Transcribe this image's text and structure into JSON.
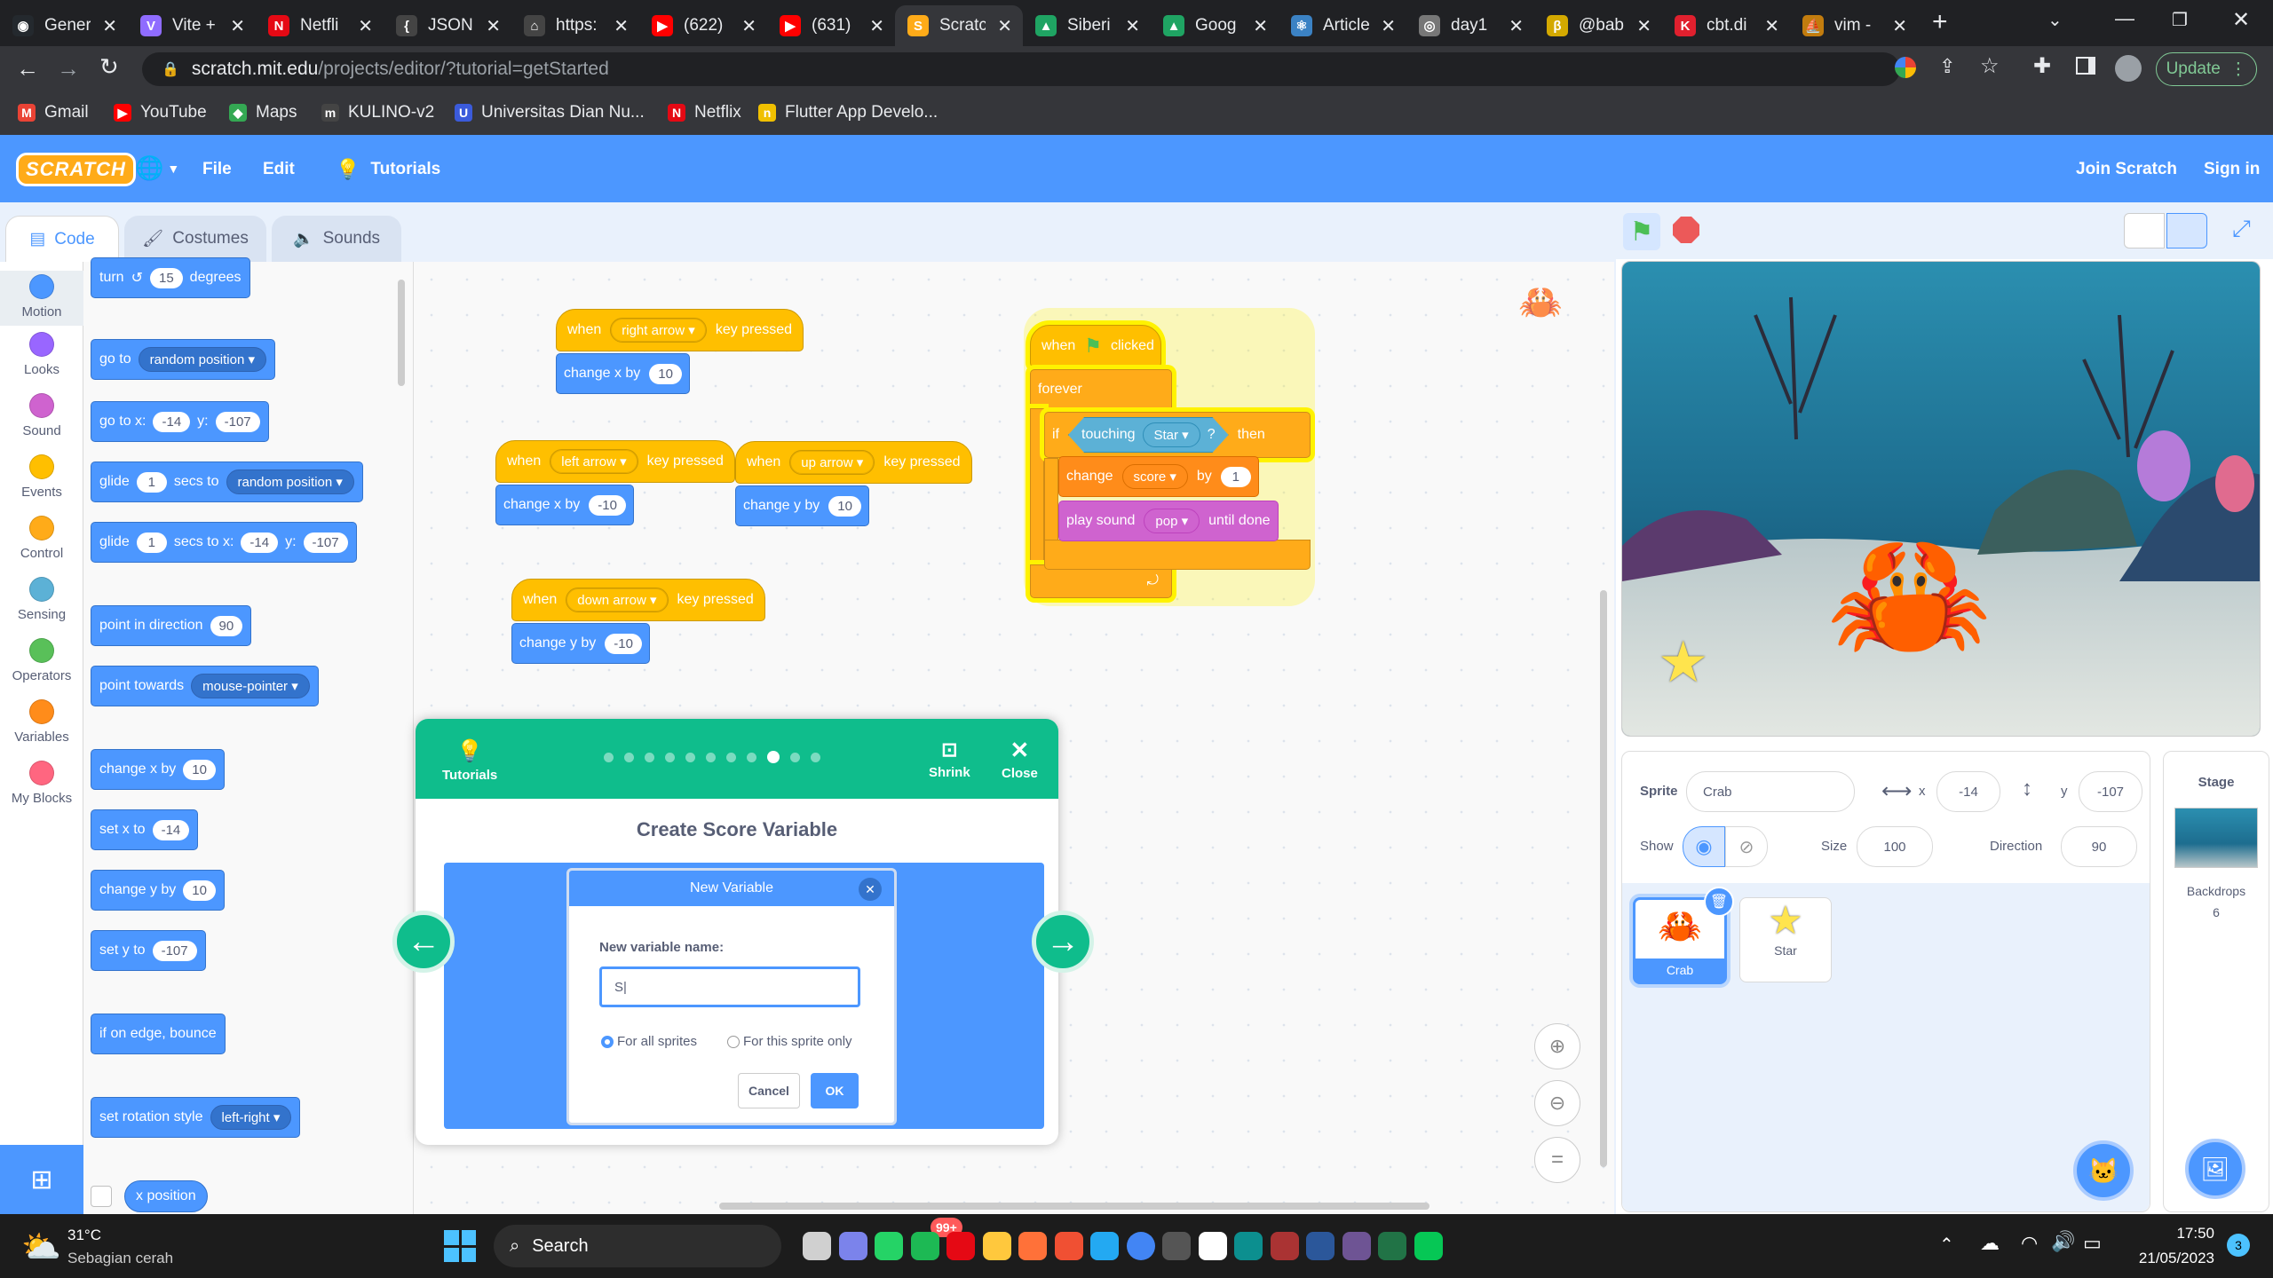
{
  "browser": {
    "tabs": [
      {
        "label": "Gener",
        "color": "#24292e",
        "glyph": "◉"
      },
      {
        "label": "Vite +",
        "color": "#8f6cff",
        "glyph": "V"
      },
      {
        "label": "Netfli",
        "color": "#e50914",
        "glyph": "N"
      },
      {
        "label": "JSON",
        "color": "#444",
        "glyph": "{"
      },
      {
        "label": "https:",
        "color": "#444",
        "glyph": "⌂"
      },
      {
        "label": "(622)",
        "color": "#ff0000",
        "glyph": "▶"
      },
      {
        "label": "(631)",
        "color": "#ff0000",
        "glyph": "▶"
      },
      {
        "label": "Scratc",
        "color": "#ffab19",
        "glyph": "S"
      },
      {
        "label": "Siberi",
        "color": "#1fa463",
        "glyph": "▲"
      },
      {
        "label": "Goog",
        "color": "#1fa463",
        "glyph": "▲"
      },
      {
        "label": "Article",
        "color": "#3b82c4",
        "glyph": "⚛"
      },
      {
        "label": "day1",
        "color": "#777",
        "glyph": "◎"
      },
      {
        "label": "@bab",
        "color": "#d4a900",
        "glyph": "β"
      },
      {
        "label": "cbt.di",
        "color": "#e0202e",
        "glyph": "K"
      },
      {
        "label": "vim -",
        "color": "#c27c0e",
        "glyph": "⛵"
      }
    ],
    "url_domain": "scratch.mit.edu",
    "url_path": "/projects/editor/?tutorial=getStarted",
    "update_label": "Update",
    "bookmarks": [
      {
        "label": "Gmail",
        "color": "#ea4335",
        "glyph": "M"
      },
      {
        "label": "YouTube",
        "color": "#ff0000",
        "glyph": "▶"
      },
      {
        "label": "Maps",
        "color": "#34a853",
        "glyph": "◆"
      },
      {
        "label": "KULINO-v2",
        "color": "#444",
        "glyph": "m"
      },
      {
        "label": "Universitas Dian Nu...",
        "color": "#3b5bdb",
        "glyph": "U"
      },
      {
        "label": "Netflix",
        "color": "#e50914",
        "glyph": "N"
      },
      {
        "label": "Flutter App Develo...",
        "color": "#f0c000",
        "glyph": "n"
      }
    ]
  },
  "menu": {
    "logo": "SCRATCH",
    "file": "File",
    "edit": "Edit",
    "tutorials": "Tutorials",
    "join": "Join Scratch",
    "signin": "Sign in"
  },
  "editor_tabs": {
    "code": "Code",
    "costumes": "Costumes",
    "sounds": "Sounds"
  },
  "categories": [
    {
      "label": "Motion",
      "color": "#4c97ff"
    },
    {
      "label": "Looks",
      "color": "#9966ff"
    },
    {
      "label": "Sound",
      "color": "#cf63cf"
    },
    {
      "label": "Events",
      "color": "#ffbf00"
    },
    {
      "label": "Control",
      "color": "#ffab19"
    },
    {
      "label": "Sensing",
      "color": "#5cb1d6"
    },
    {
      "label": "Operators",
      "color": "#59c059"
    },
    {
      "label": "Variables",
      "color": "#ff8c1a"
    },
    {
      "label": "My Blocks",
      "color": "#ff6680"
    }
  ],
  "palette": {
    "turn": "turn",
    "turn_val": "15",
    "degrees": "degrees",
    "goto": "go to",
    "goto_dd": "random position",
    "gotoxy": "go to x:",
    "gotoxy_x": "-14",
    "y": "y:",
    "gotoxy_y": "-107",
    "glide": "glide",
    "glide_val": "1",
    "secs_to": "secs to",
    "glide_dd": "random position",
    "glide2": "glide",
    "glide2_val": "1",
    "secs_to_x": "secs to x:",
    "glide2_x": "-14",
    "glide2_y": "-107",
    "point_dir": "point in direction",
    "point_dir_val": "90",
    "point_towards": "point towards",
    "point_towards_dd": "mouse-pointer",
    "change_x": "change x by",
    "change_x_val": "10",
    "set_x": "set x to",
    "set_x_val": "-14",
    "change_y": "change y by",
    "change_y_val": "10",
    "set_y": "set y to",
    "set_y_val": "-107",
    "bounce": "if on edge, bounce",
    "rotation": "set rotation style",
    "rotation_dd": "left-right",
    "xpos": "x position"
  },
  "scripts": {
    "when": "when",
    "key_pressed": "key pressed",
    "right_arrow": "right arrow",
    "left_arrow": "left arrow",
    "up_arrow": "up arrow",
    "down_arrow": "down arrow",
    "change_x_by": "change x by",
    "change_y_by": "change y by",
    "v10": "10",
    "vneg10": "-10",
    "clicked": "clicked",
    "forever": "forever",
    "if": "if",
    "then": "then",
    "touching": "touching",
    "touching_dd": "Star",
    "q": "?",
    "change": "change",
    "score_dd": "score",
    "by": "by",
    "one": "1",
    "play_sound": "play sound",
    "pop_dd": "pop",
    "until_done": "until done"
  },
  "tutorial": {
    "tutorials_label": "Tutorials",
    "shrink": "Shrink",
    "close": "Close",
    "title": "Create Score Variable",
    "dialog_title": "New Variable",
    "name_label": "New variable name:",
    "name_value": "S|",
    "for_all": "For all sprites",
    "for_this": "For this sprite only",
    "cancel": "Cancel",
    "ok": "OK",
    "progress_total": 11,
    "progress_current": 9
  },
  "sprite_info": {
    "sprite_label": "Sprite",
    "sprite_name": "Crab",
    "x_label": "x",
    "x_val": "-14",
    "y_label": "y",
    "y_val": "-107",
    "show_label": "Show",
    "size_label": "Size",
    "size_val": "100",
    "direction_label": "Direction",
    "direction_val": "90",
    "sprites": [
      "Crab",
      "Star"
    ]
  },
  "stage_panel": {
    "title": "Stage",
    "backdrops_label": "Backdrops",
    "backdrops_count": "6"
  },
  "taskbar": {
    "temp": "31°C",
    "weather": "Sebagian cerah",
    "search": "Search",
    "badge": "99+",
    "time": "17:50",
    "date": "21/05/2023",
    "notif": "3"
  }
}
